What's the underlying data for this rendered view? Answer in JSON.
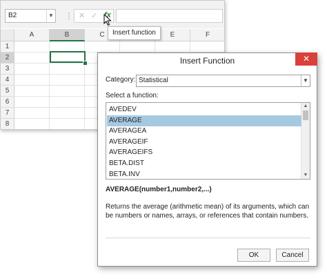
{
  "sheet": {
    "name_box": "B2",
    "name_box_icon": "chevron-down-icon",
    "formula_cancel_icon": "cross-icon",
    "formula_enter_icon": "check-icon",
    "insert_function_label": "fx",
    "tooltip": "Insert function",
    "columns": [
      "A",
      "B",
      "C",
      "D",
      "E",
      "F"
    ],
    "selected_column": "B",
    "rows": [
      "1",
      "2",
      "3",
      "4",
      "5",
      "6",
      "7",
      "8"
    ],
    "selected_row": "2",
    "accent_color": "#217346"
  },
  "dialog": {
    "title": "Insert Function",
    "close_icon": "close-icon",
    "close_color": "#d9413a",
    "category_label": "Category:",
    "category_value": "Statistical",
    "select_label": "Select a function:",
    "functions": [
      "AVEDEV",
      "AVERAGE",
      "AVERAGEA",
      "AVERAGEIF",
      "AVERAGEIFS",
      "BETA.DIST",
      "BETA.INV"
    ],
    "selected_function": "AVERAGE",
    "selection_color": "#a6c9e2",
    "signature": "AVERAGE(number1,number2,...)",
    "description": "Returns the average (arithmetic mean) of its arguments, which can be numbers or names, arrays, or references that contain numbers.",
    "ok_label": "OK",
    "cancel_label": "Cancel"
  }
}
